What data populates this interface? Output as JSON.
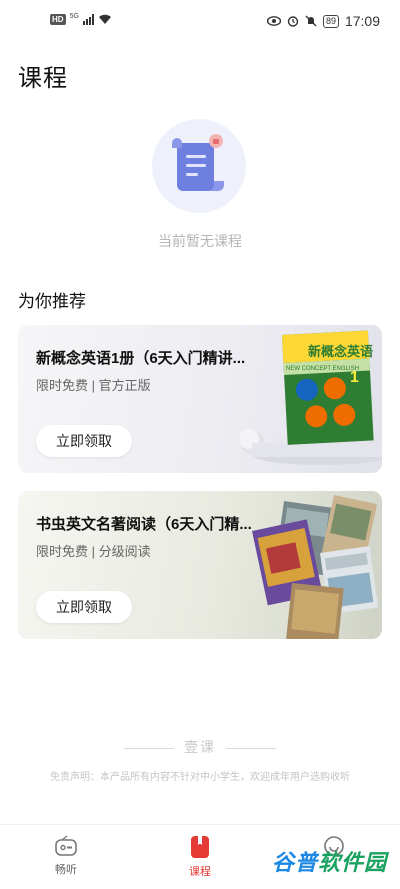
{
  "status_bar": {
    "hd": "HD",
    "signal_type": "5G",
    "time": "17:09",
    "battery": "89"
  },
  "page": {
    "title": "课程"
  },
  "empty_state": {
    "icon": "document-lock-icon",
    "text": "当前暂无课程"
  },
  "recommend": {
    "title": "为你推荐",
    "cards": [
      {
        "title": "新概念英语1册（6天入门精讲...",
        "subtitle": "限时免费 | 官方正版",
        "button": "立即领取",
        "book_title": "新概念英语",
        "book_subtitle": "NEW CONCEPT ENGLISH",
        "book_number": "1"
      },
      {
        "title": "书虫英文名著阅读（6天入门精...",
        "subtitle": "限时免费 | 分级阅读",
        "button": "立即领取"
      }
    ]
  },
  "footer": {
    "brand": "壹课",
    "disclaimer": "免责声明：本产品所有内容不针对中小学生，欢迎成年用户选购收听"
  },
  "bottom_nav": {
    "items": [
      {
        "label": "畅听",
        "icon": "radio-icon",
        "active": false
      },
      {
        "label": "课程",
        "icon": "course-icon",
        "active": true
      },
      {
        "label": "",
        "icon": "profile-icon",
        "active": false
      }
    ]
  },
  "watermark": {
    "text_a": "谷普",
    "text_b": "软件园"
  },
  "colors": {
    "accent": "#e53935",
    "empty_icon_bg": "#eef0fb",
    "empty_icon_fg": "#6f7fe0"
  }
}
